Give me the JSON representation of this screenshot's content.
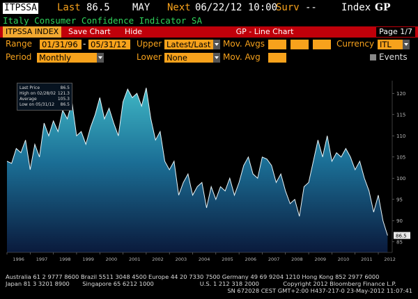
{
  "header": {
    "ticker": "ITPSSA",
    "last_label": "Last",
    "last_value": "86.5",
    "period": "MAY",
    "next_label": "Next",
    "next_value": "06/22/12 10:00",
    "surv_label": "Surv",
    "surv_value": "--",
    "index_label": "Index",
    "function_code": "GP"
  },
  "subtitle": "Italy Consumer Confidence Indicator SA",
  "toolbar": {
    "index_tab": "ITPSSA INDEX",
    "save_chart": "Save Chart",
    "hide": "Hide",
    "chart_type": "GP - Line Chart",
    "page": "Page 1/7"
  },
  "controls": {
    "range_label": "Range",
    "range_start": "01/31/96",
    "range_sep": "-",
    "range_end": "05/31/12",
    "upper_label": "Upper",
    "upper_value": "Latest/Last",
    "mov_avgs_label": "Mov. Avgs",
    "currency_label": "Currency",
    "currency_value": "ITL",
    "period_label": "Period",
    "period_value": "Monthly",
    "lower_label": "Lower",
    "lower_value": "None",
    "mov_avg_label": "Mov. Avg",
    "events_label": "Events"
  },
  "legend": {
    "items": [
      {
        "label": "Last Price",
        "value": "86.5"
      },
      {
        "label": "High on 02/28/02",
        "value": "121.3"
      },
      {
        "label": "Average",
        "value": "105.3"
      },
      {
        "label": "Low on 05/31/12",
        "value": "86.5"
      }
    ]
  },
  "chart_data": {
    "type": "area",
    "x_ticks": [
      "1996",
      "1997",
      "1998",
      "1999",
      "2000",
      "2001",
      "2002",
      "2003",
      "2004",
      "2005",
      "2006",
      "2007",
      "2008",
      "2009",
      "2010",
      "2011",
      "2012"
    ],
    "y_ticks": [
      85,
      90,
      95,
      100,
      105,
      110,
      115,
      120
    ],
    "ylim": [
      82.5,
      123
    ],
    "xlim": [
      1996.0,
      2012.6
    ],
    "last_value_tag": "86.5",
    "series": [
      {
        "x": [
          1996.0,
          1996.2,
          1996.4,
          1996.6,
          1996.8,
          1997.0,
          1997.2,
          1997.4,
          1997.6,
          1997.8,
          1998.0,
          1998.2,
          1998.4,
          1998.6,
          1998.8,
          1999.0,
          1999.2,
          1999.4,
          1999.6,
          1999.8,
          2000.0,
          2000.2,
          2000.4,
          2000.6,
          2000.8,
          2001.0,
          2001.2,
          2001.4,
          2001.6,
          2001.8,
          2002.0,
          2002.2,
          2002.4,
          2002.6,
          2002.8,
          2003.0,
          2003.2,
          2003.4,
          2003.6,
          2003.8,
          2004.0,
          2004.2,
          2004.4,
          2004.6,
          2004.8,
          2005.0,
          2005.2,
          2005.4,
          2005.6,
          2005.8,
          2006.0,
          2006.2,
          2006.4,
          2006.6,
          2006.8,
          2007.0,
          2007.2,
          2007.4,
          2007.6,
          2007.8,
          2008.0,
          2008.2,
          2008.4,
          2008.6,
          2008.8,
          2009.0,
          2009.2,
          2009.4,
          2009.6,
          2009.8,
          2010.0,
          2010.2,
          2010.4,
          2010.6,
          2010.8,
          2011.0,
          2011.2,
          2011.4,
          2011.6,
          2011.8,
          2012.0,
          2012.2,
          2012.4
        ],
        "y": [
          104,
          103.5,
          107,
          106,
          109,
          102,
          108,
          105,
          113,
          110,
          113.5,
          111,
          116,
          114,
          118,
          110,
          111,
          108,
          112,
          115,
          119,
          114,
          116.5,
          113,
          110,
          118,
          121,
          119,
          120,
          117,
          121.3,
          114,
          109,
          111,
          104,
          102,
          104,
          96,
          99,
          101,
          96,
          98,
          99,
          93,
          98,
          95,
          98,
          97,
          100,
          96,
          99,
          103,
          105,
          101,
          100,
          105,
          104.5,
          103,
          99,
          101,
          97,
          94,
          95,
          91,
          98,
          99,
          104,
          109,
          105,
          110,
          104,
          106,
          105,
          107,
          105,
          102,
          104,
          100,
          97,
          92,
          96,
          90,
          86.5
        ]
      }
    ]
  }
}
